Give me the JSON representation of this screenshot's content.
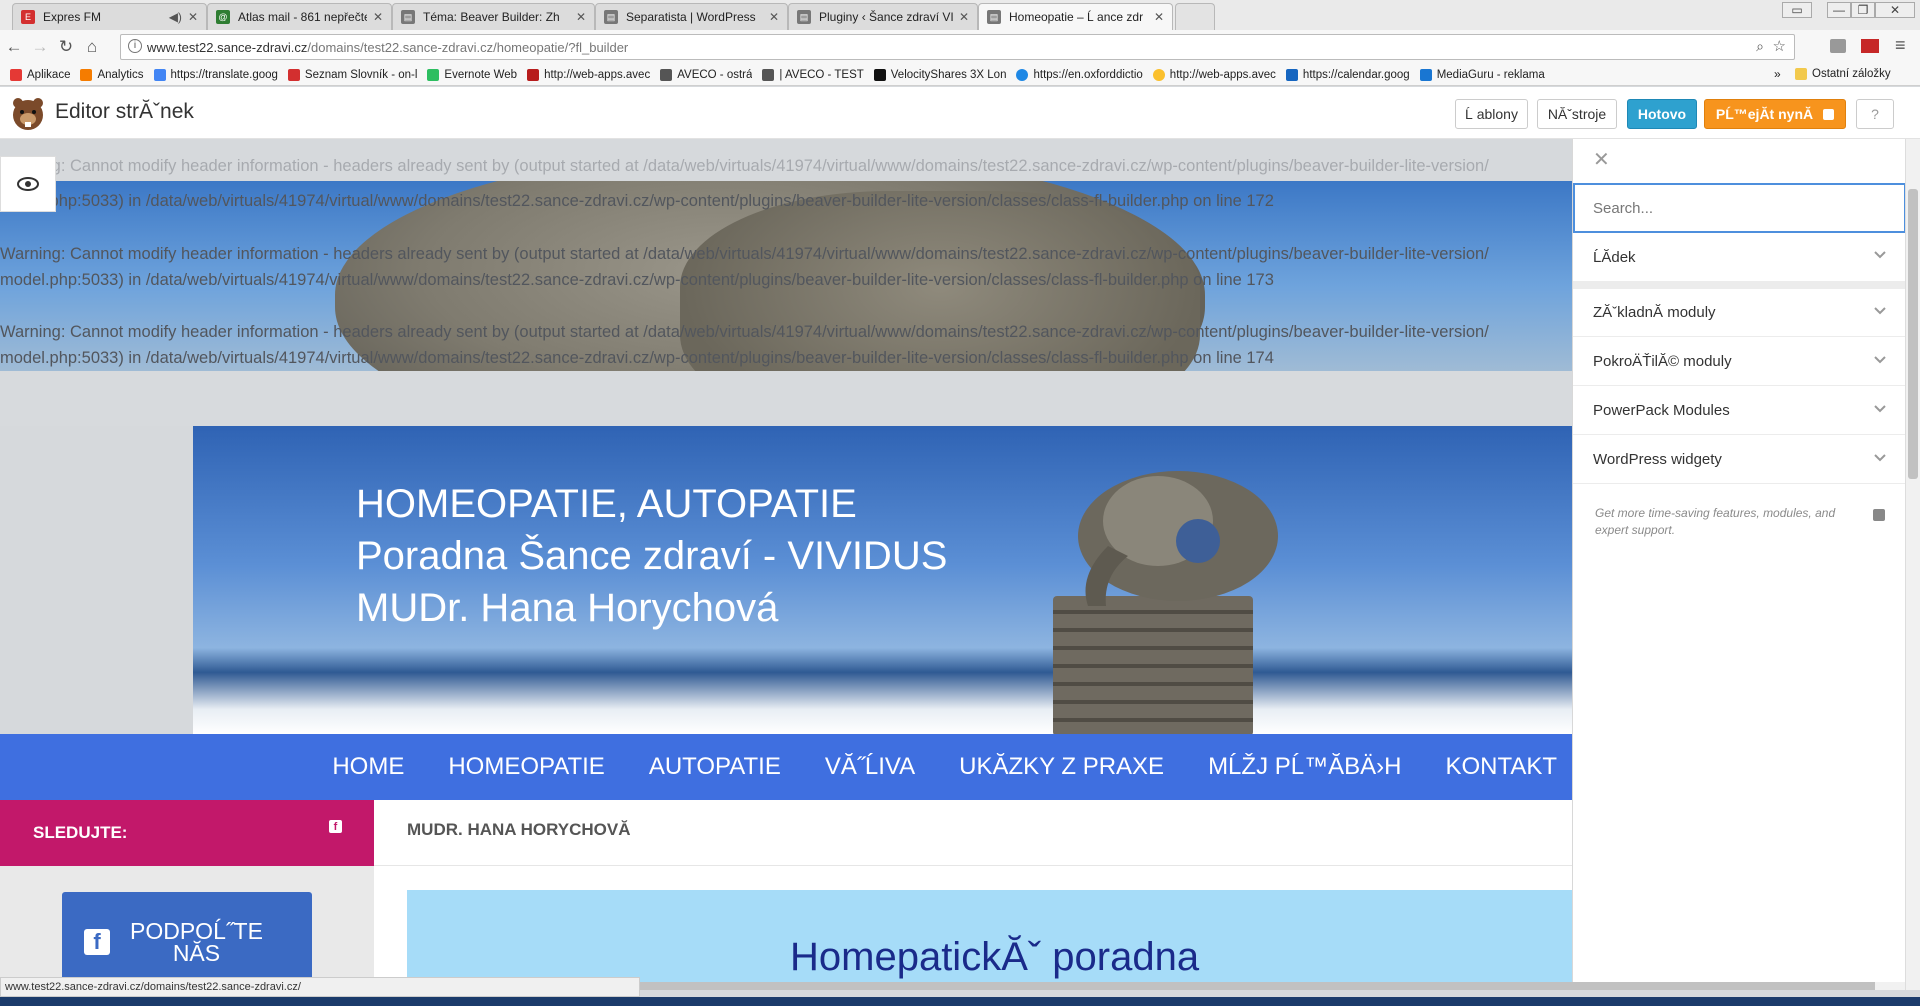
{
  "tabs": [
    {
      "title": "Expres FM",
      "favicon_color": "#d32f2f",
      "favicon": "E",
      "audio": true
    },
    {
      "title": "Atlas mail - 861 nepřečte",
      "favicon_color": "#2e7d32",
      "favicon": "@"
    },
    {
      "title": "Téma: Beaver Builder: Zh",
      "favicon_color": "#777777",
      "favicon": "▤"
    },
    {
      "title": "Separatista | WordPress",
      "favicon_color": "#777777",
      "favicon": "▤"
    },
    {
      "title": "Pluginy ‹ Šance zdraví VI",
      "favicon_color": "#777777",
      "favicon": "▤"
    },
    {
      "title": "Homeopatie – Ĺ ance zdr",
      "favicon_color": "#777777",
      "favicon": "▤",
      "active": true
    }
  ],
  "window": {
    "user_label": "",
    "minimize": "—",
    "restore": "❐",
    "close": "✕"
  },
  "address": {
    "url_host": "www.test22.sance-zdravi.cz",
    "url_path": "/domains/test22.sance-zdravi.cz/homeopatie/?fl_builder"
  },
  "bookmarks": [
    {
      "label": "Aplikace",
      "color": "#e53935"
    },
    {
      "label": "Analytics",
      "color": "#f57c00"
    },
    {
      "label": "https://translate.goog",
      "color": "#4285f4"
    },
    {
      "label": "Seznam Slovník - on-l",
      "color": "#d32f2f"
    },
    {
      "label": "Evernote Web",
      "color": "#2dbe60"
    },
    {
      "label": "http://web-apps.avec",
      "color": "#b71c1c"
    },
    {
      "label": "AVECO - ostrá",
      "color": "#555555"
    },
    {
      "label": "| AVECO - TEST",
      "color": "#555555"
    },
    {
      "label": "VelocityShares 3X Lon",
      "color": "#111111"
    },
    {
      "label": "https://en.oxforddictio",
      "color": "#1e88e5"
    },
    {
      "label": "http://web-apps.avec",
      "color": "#fbc02d"
    },
    {
      "label": "https://calendar.goog",
      "color": "#1565c0"
    },
    {
      "label": "MediaGuru - reklama",
      "color": "#1976d2"
    }
  ],
  "bookmarks_more": "»",
  "bookmarks_other": "Ostatní záložky",
  "builder": {
    "title": "Editor strĂˇnek",
    "btn_templates": "Ĺ ablony",
    "btn_tools": "NĂˇstroje",
    "btn_done": "Hotovo",
    "btn_upgrade": "PĹ™ejĂt nynĂ",
    "btn_help": "?"
  },
  "warnings": [
    "Warning: Cannot modify header information - headers already sent by (output started at /data/web/virtuals/41974/virtual/www/domains/test22.sance-zdravi.cz/wp-content/plugins/beaver-builder-lite-version/",
    "model.php:5033) in /data/web/virtuals/41974/virtual/www/domains/test22.sance-zdravi.cz/wp-content/plugins/beaver-builder-lite-version/classes/class-fl-builder.php on line 172",
    "Warning: Cannot modify header information - headers already sent by (output started at /data/web/virtuals/41974/virtual/www/domains/test22.sance-zdravi.cz/wp-content/plugins/beaver-builder-lite-version/",
    "model.php:5033) in /data/web/virtuals/41974/virtual/www/domains/test22.sance-zdravi.cz/wp-content/plugins/beaver-builder-lite-version/classes/class-fl-builder.php on line 173",
    "Warning: Cannot modify header information - headers already sent by (output started at /data/web/virtuals/41974/virtual/www/domains/test22.sance-zdravi.cz/wp-content/plugins/beaver-builder-lite-version/",
    "model.php:5033) in /data/web/virtuals/41974/virtual/www/domains/test22.sance-zdravi.cz/wp-content/plugins/beaver-builder-lite-version/classes/class-fl-builder.php on line 174"
  ],
  "banner": {
    "line1": "HOMEOPATIE, AUTOPATIE",
    "line2": "Poradna Šance zdraví - VIVIDUS",
    "line3": "MUDr. Hana Horychová"
  },
  "menu": [
    "HOME",
    "HOMEOPATIE",
    "AUTOPATIE",
    "VĂ˝ĹIVA",
    "UKĂZKY Z PRAXE",
    "MĹŽJ PĹ™ĂBÄ›H",
    "KONTAKT"
  ],
  "sidebar": {
    "follow_label": "SLEDUJTE:",
    "support_label_1": "PODPOĹ˝TE",
    "support_label_2": "NĂS"
  },
  "main": {
    "heading": "MUDR. HANA HORYCHOVĂ",
    "box_title": "HomepatickĂˇ poradna"
  },
  "panel": {
    "search_placeholder": "Search...",
    "rows": [
      "ĹĂdek",
      "ZĂˇkladnĂ moduly",
      "PokroÄŤilĂ© moduly",
      "PowerPack Modules",
      "WordPress widgety"
    ],
    "promo": "Get more time-saving features, modules, and expert support."
  },
  "status_url": "www.test22.sance-zdravi.cz/domains/test22.sance-zdravi.cz/"
}
